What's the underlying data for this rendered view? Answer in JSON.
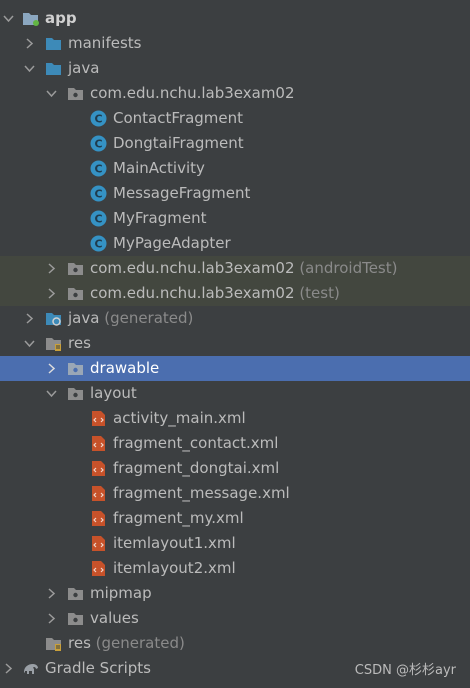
{
  "tree": {
    "app": "app",
    "manifests": "manifests",
    "java": "java",
    "package_main": "com.edu.nchu.lab3exam02",
    "classes": [
      "ContactFragment",
      "DongtaiFragment",
      "MainActivity",
      "MessageFragment",
      "MyFragment",
      "MyPageAdapter"
    ],
    "package_android_test": "com.edu.nchu.lab3exam02",
    "android_test_suffix": "(androidTest)",
    "package_test": "com.edu.nchu.lab3exam02",
    "test_suffix": "(test)",
    "java_generated": "java",
    "generated_suffix": "(generated)",
    "res": "res",
    "drawable": "drawable",
    "layout": "layout",
    "layout_files": [
      "activity_main.xml",
      "fragment_contact.xml",
      "fragment_dongtai.xml",
      "fragment_message.xml",
      "fragment_my.xml",
      "itemlayout1.xml",
      "itemlayout2.xml"
    ],
    "mipmap": "mipmap",
    "values": "values",
    "res_generated": "res",
    "res_generated_suffix": "(generated)",
    "gradle_scripts": "Gradle Scripts"
  },
  "watermark": "CSDN @杉杉ayr",
  "colors": {
    "background": "#3c3f41",
    "selection": "#4b6eaf",
    "test_highlight": "#43473f",
    "folder_blue": "#3d8ab8",
    "class_icon": "#3592c4",
    "xml_icon": "#c7522a"
  }
}
